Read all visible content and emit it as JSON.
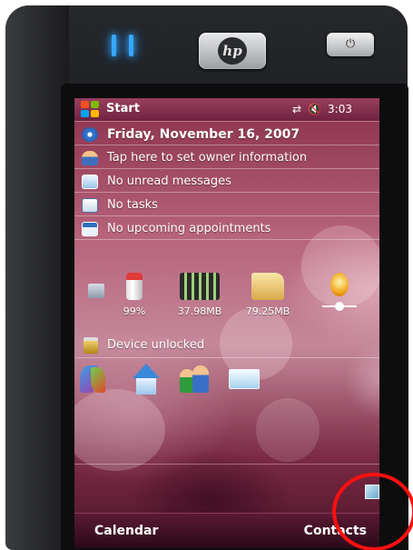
{
  "device": {
    "brand_logo": "hp"
  },
  "titlebar": {
    "start_label": "Start",
    "time": "3:03",
    "icons": [
      "windows-flag-icon",
      "connectivity-icon",
      "speaker-muted-icon"
    ]
  },
  "today": {
    "date": "Friday, November 16, 2007",
    "owner": "Tap here to set owner information",
    "messages": "No unread messages",
    "tasks": "No tasks",
    "appointments": "No upcoming appointments",
    "system": {
      "battery": "99%",
      "memory": "37.98MB",
      "storage": "79.25MB"
    },
    "lock": "Device unlocked"
  },
  "softkeys": {
    "left": "Calendar",
    "right": "Contacts"
  },
  "colors": {
    "annotation_circle": "#ff1010",
    "accent": "#8a2f4a"
  }
}
